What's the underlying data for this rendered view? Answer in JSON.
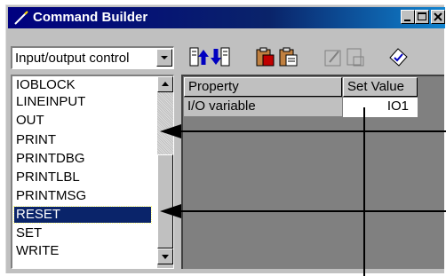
{
  "window": {
    "title": "Command Builder"
  },
  "category": {
    "selected": "Input/output control"
  },
  "commands": {
    "items": [
      "IOBLOCK",
      "LINEINPUT",
      "OUT",
      "PRINT",
      "PRINTDBG",
      "PRINTLBL",
      "PRINTMSG",
      "RESET",
      "SET",
      "WRITE"
    ],
    "selected": "RESET"
  },
  "properties": {
    "headers": [
      "Property",
      "Set Value"
    ],
    "rows": [
      {
        "property": "I/O variable",
        "value": "IO1"
      }
    ]
  },
  "toolbar": {
    "buttons": [
      "move-up-icon",
      "move-down-icon",
      "cut-icon",
      "paste-icon",
      "edit-disabled-icon",
      "delete-disabled-icon",
      "check-icon"
    ]
  },
  "colors": {
    "titlebar": "#000080",
    "selection": "#0a246a",
    "face": "#c0c0c0"
  }
}
